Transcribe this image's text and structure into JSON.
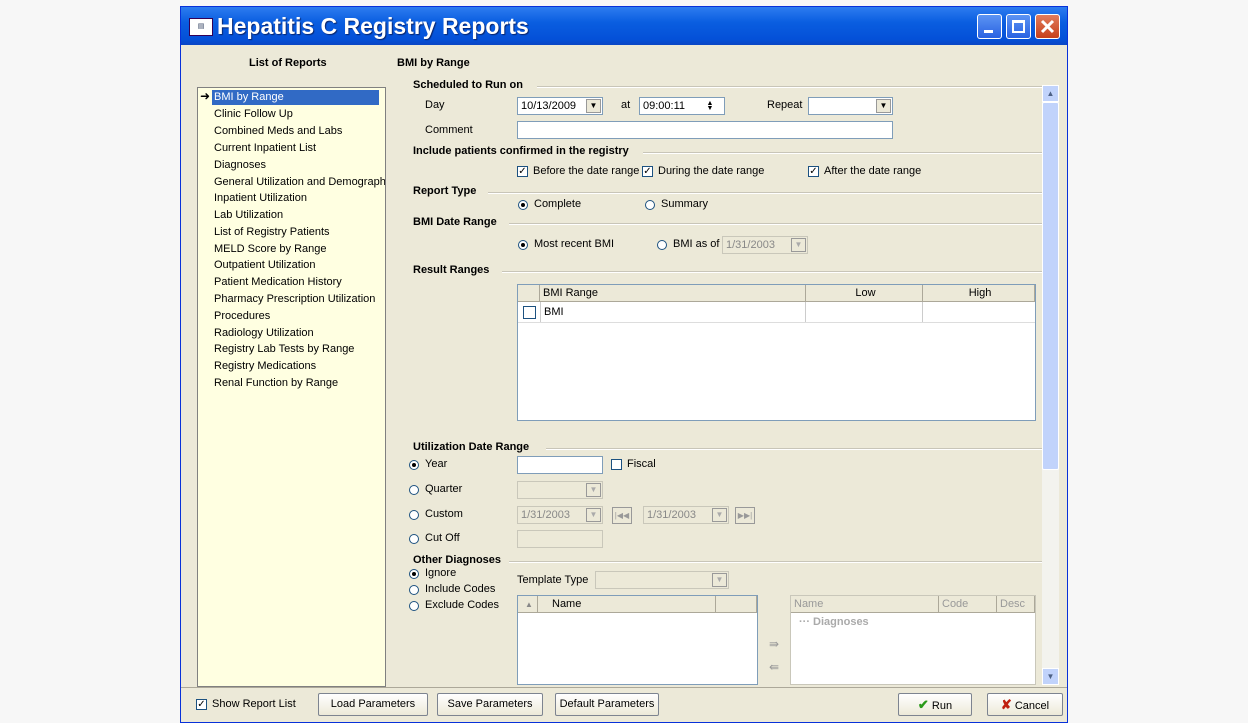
{
  "window": {
    "title": "Hepatitis C Registry Reports"
  },
  "left": {
    "header": "List of Reports",
    "selected_arrow": "➜",
    "items": [
      "BMI by Range",
      "Clinic Follow Up",
      "Combined Meds and Labs",
      "Current Inpatient List",
      "Diagnoses",
      "General Utilization and Demograph...",
      "Inpatient Utilization",
      "Lab Utilization",
      "List of Registry Patients",
      "MELD Score by Range",
      "Outpatient Utilization",
      "Patient Medication History",
      "Pharmacy Prescription Utilization",
      "Procedures",
      "Radiology Utilization",
      "Registry Lab Tests by Range",
      "Registry Medications",
      "Renal Function by Range"
    ]
  },
  "report_title": "BMI by Range",
  "scheduled": {
    "section": "Scheduled to Run on",
    "day_label": "Day",
    "day_value": "10/13/2009",
    "at_label": "at",
    "time_value": "09:00:11",
    "repeat_label": "Repeat",
    "repeat_value": "",
    "comment_label": "Comment",
    "comment_value": ""
  },
  "include": {
    "section": "Include patients confirmed in the registry",
    "before": "Before the date range",
    "during": "During the date range",
    "after": "After the date range"
  },
  "report_type": {
    "section": "Report Type",
    "complete": "Complete",
    "summary": "Summary"
  },
  "bmi_date_range": {
    "section": "BMI Date Range",
    "most_recent": "Most recent BMI",
    "bmi_as_of": "BMI as of",
    "as_of_value": "1/31/2003"
  },
  "result_ranges": {
    "section": "Result Ranges",
    "columns": [
      "BMI Range",
      "Low",
      "High"
    ],
    "rows": [
      {
        "name": "BMI",
        "low": "",
        "high": ""
      }
    ]
  },
  "utilization": {
    "section": "Utilization Date Range",
    "year": "Year",
    "year_value": "",
    "fiscal": "Fiscal",
    "quarter": "Quarter",
    "custom": "Custom",
    "custom_from": "1/31/2003",
    "custom_to": "1/31/2003",
    "cutoff": "Cut Off"
  },
  "other_diagnoses": {
    "section": "Other Diagnoses",
    "ignore": "Ignore",
    "include_codes": "Include Codes",
    "exclude_codes": "Exclude Codes",
    "template_type_label": "Template Type",
    "template_type_value": "",
    "left_columns": [
      "Name"
    ],
    "right_columns": [
      "Name",
      "Code",
      "Desc"
    ],
    "right_group": "Diagnoses"
  },
  "footer": {
    "show_report_list": "Show Report List",
    "load": "Load Parameters",
    "save": "Save Parameters",
    "default": "Default Parameters",
    "run": "Run",
    "cancel": "Cancel"
  }
}
